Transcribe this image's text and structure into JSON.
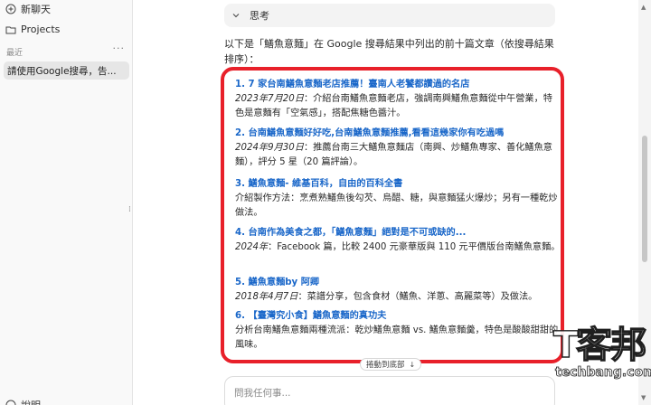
{
  "sidebar": {
    "new_chat": "新聊天",
    "projects": "Projects",
    "section_recent": "最近",
    "more": "···",
    "chat_item": "請使用Google搜尋，告...",
    "bottom_item": "說明"
  },
  "main": {
    "think_label": "思考",
    "intro": "以下是「鱔魚意麵」在 Google 搜尋結果中列出的前十篇文章（依搜尋結果排序）：",
    "results": [
      {
        "num": "1.",
        "title": "7 家台南鱔魚意麵老店推薦！臺南人老饕都讚過的名店",
        "date": "2023年7月20日",
        "desc": "：介紹台南鱔魚意麵老店，強調南興鱔魚意麵從中午營業，特色是意麵有「空氣感」，搭配焦糖色醬汁。"
      },
      {
        "num": "2.",
        "title": "台南鱔魚意麵好好吃,台南鱔魚意麵推薦,看看這幾家你有吃過嗎",
        "date": "2024年9月30日",
        "desc": "：推薦台南三大鱔魚意麵店（南興、炒鱔魚專家、善化鱔魚意麵），評分 5 星（20 篇評論）。"
      },
      {
        "num": "3.",
        "title": "鱔魚意麵- 維基百科，自由的百科全書",
        "date": "",
        "desc": "介紹製作方法：烹煮熟鱔魚後勾芡、烏醋、糖，與意麵猛火爆炒；另有一種乾炒做法。"
      },
      {
        "num": "4.",
        "title": "台南作為美食之都，「鱔魚意麵」絕對是不可或缺的...",
        "date": "2024年",
        "desc": "：Facebook 篇，比較 2400 元豪華版與 110 元平價版台南鱔魚意麵。"
      },
      {
        "num": "5.",
        "title": "鱔魚意麵by 阿卿",
        "date": "2018年4月7日",
        "desc": "：菜譜分享，包含食材（鱔魚、洋蔥、高麗菜等）及做法。"
      },
      {
        "num": "6.",
        "title": "【臺灣究小食】鱔魚意麵的真功夫",
        "date": "",
        "desc": "分析台南鱔魚意麵兩種流派：乾炒鱔魚意麵 vs. 鱔魚意麵羹，特色是酸酸甜甜的風味。"
      }
    ],
    "scroll_to_bottom": "捲動到底部",
    "input_placeholder": "問我任何事..."
  },
  "watermark": {
    "logo": "T客邦",
    "site": "techbang.com"
  },
  "colors": {
    "accent_red": "#e8202a",
    "link_blue": "#1a67c9"
  }
}
